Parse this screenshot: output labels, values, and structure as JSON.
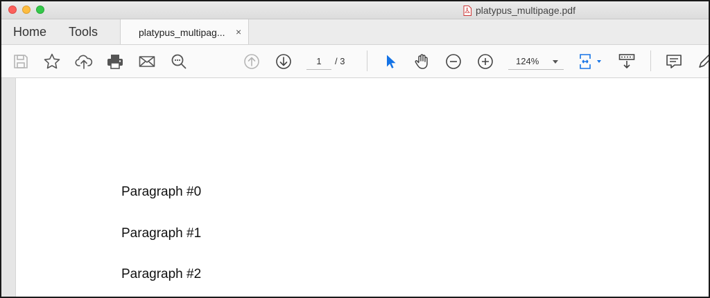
{
  "window": {
    "title": "platypus_multipage.pdf"
  },
  "tabs": {
    "home": "Home",
    "tools": "Tools",
    "document_tab": "platypus_multipag...",
    "close_glyph": "×"
  },
  "toolbar": {
    "page_current": "1",
    "page_total": "/ 3",
    "zoom": "124%",
    "accent_color": "#1473e6"
  },
  "document": {
    "paragraphs": [
      "Paragraph #0",
      "Paragraph #1",
      "Paragraph #2"
    ]
  }
}
